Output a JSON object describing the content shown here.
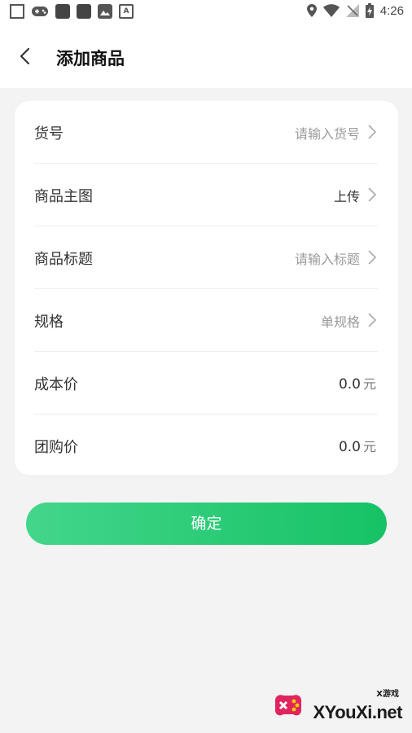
{
  "statusbar": {
    "time": "4:26"
  },
  "header": {
    "title": "添加商品"
  },
  "form": {
    "rows": [
      {
        "label": "货号",
        "value": "请输入货号"
      },
      {
        "label": "商品主图",
        "value": "上传"
      },
      {
        "label": "商品标题",
        "value": "请输入标题"
      },
      {
        "label": "规格",
        "value": "单规格"
      },
      {
        "label": "成本价",
        "value": "0.0",
        "unit": "元"
      },
      {
        "label": "团购价",
        "value": "0.0",
        "unit": "元"
      }
    ]
  },
  "actions": {
    "confirm_label": "确定"
  },
  "watermark": {
    "text": "XYouXi.net",
    "small": "X游戏"
  },
  "colors": {
    "accent_start": "#43d68b",
    "accent_end": "#16c265",
    "background": "#f3f3f3"
  }
}
